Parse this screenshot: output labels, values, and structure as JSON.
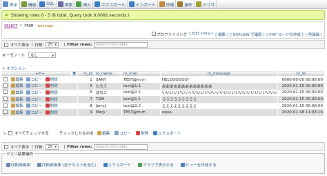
{
  "tabs": [
    {
      "label": "表示",
      "color": "#5a88c9"
    },
    {
      "label": "構造",
      "color": "#7a9a3a"
    },
    {
      "label": "SQL",
      "color": "#3a7ac0"
    },
    {
      "label": "検索",
      "color": "#6a6aa0"
    },
    {
      "label": "挿入",
      "color": "#4aa04a"
    },
    {
      "label": "エクスポート",
      "color": "#3a80c0"
    },
    {
      "label": "インポート",
      "color": "#3a80c0"
    },
    {
      "label": "特権",
      "color": "#c08a3a"
    },
    {
      "label": "操作",
      "color": "#a07a30"
    },
    {
      "label": "トリガ",
      "color": "#a0a030"
    }
  ],
  "success_message": "Showing rows 0 - 5 (6 total, Query took 0.0002 seconds.)",
  "sql": {
    "select": "SELECT",
    "rest": " * FROM ",
    "table": "`message`"
  },
  "sql_links": [
    "プロファイリング",
    "[ Edit inline ]",
    "[ 編集 ]",
    "[ EXPLAIN で確認 ]",
    "[ PHP コードの作成 ]",
    "[ 再描画 ]"
  ],
  "nav": {
    "show_all": "すべて表示",
    "rows_label": "行数:",
    "rows_value": "25",
    "filter_label": "Filter rows:",
    "filter_placeholder": "Search this table"
  },
  "sort": {
    "label": "キーでソート:",
    "value": "なし"
  },
  "options_label": "+ オプション",
  "table": {
    "headers": [
      "m_id",
      "m_name",
      "m_mail",
      "m_message",
      "m_dt"
    ],
    "actions": {
      "edit": "編集",
      "copy": "コピー",
      "delete": "削除"
    },
    "rows": [
      [
        "1",
        "SANY",
        "TEST@m.m",
        "HELOOOOOO!",
        "0000-00-00 00:00:00"
      ],
      [
        "5",
        "たろう",
        "test@1.1",
        "あああああああああああああ",
        "2020-01-15 00:00:00"
      ],
      [
        "6",
        "はなこ",
        "test@2.2",
        "いいいいいいいいいいいいいいいいいいいいいいいいいいいいいいいいいい",
        "2020-01-15 00:00:00"
      ],
      [
        "7",
        "TOM",
        "test@1.1",
        "ううううううううう",
        "2020-01-15 00:00:00"
      ],
      [
        "8",
        "JerryJ",
        "test@2.2",
        "えええええええええ",
        "2020-01-15 00:00:00"
      ],
      [
        "9",
        "Mary",
        "TEST@m.m",
        "aqua",
        "2020-01-18 11:03:16"
      ]
    ]
  },
  "with_selected": {
    "check_all": "すべてチェックする",
    "label": "チェックしたものを:",
    "edit": "編集",
    "copy": "コピー",
    "delete": "削除",
    "export": "エクスポート"
  },
  "query_ops": {
    "legend": "クエリ結果操作",
    "items": [
      "印刷用画面",
      "印刷用画面 (全テキストを含む)",
      "エクスポート",
      "グラフで表示する",
      "ビューを作成する"
    ]
  }
}
